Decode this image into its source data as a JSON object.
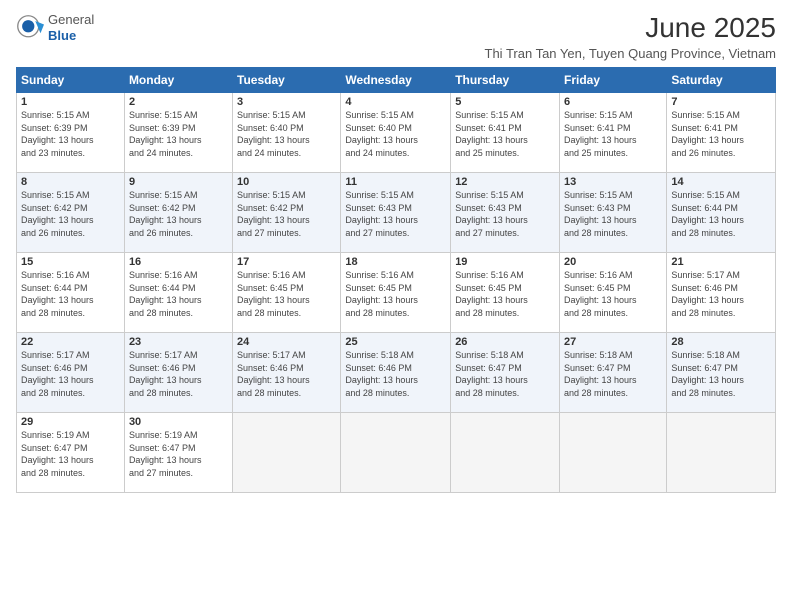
{
  "header": {
    "logo": {
      "general": "General",
      "blue": "Blue"
    },
    "title": "June 2025",
    "subtitle": "Thi Tran Tan Yen, Tuyen Quang Province, Vietnam"
  },
  "days_of_week": [
    "Sunday",
    "Monday",
    "Tuesday",
    "Wednesday",
    "Thursday",
    "Friday",
    "Saturday"
  ],
  "weeks": [
    [
      {
        "day": "1",
        "rise": "Sunrise: 5:15 AM",
        "set": "Sunset: 6:39 PM",
        "light": "Daylight: 13 hours and 23 minutes."
      },
      {
        "day": "2",
        "rise": "Sunrise: 5:15 AM",
        "set": "Sunset: 6:39 PM",
        "light": "Daylight: 13 hours and 24 minutes."
      },
      {
        "day": "3",
        "rise": "Sunrise: 5:15 AM",
        "set": "Sunset: 6:40 PM",
        "light": "Daylight: 13 hours and 24 minutes."
      },
      {
        "day": "4",
        "rise": "Sunrise: 5:15 AM",
        "set": "Sunset: 6:40 PM",
        "light": "Daylight: 13 hours and 24 minutes."
      },
      {
        "day": "5",
        "rise": "Sunrise: 5:15 AM",
        "set": "Sunset: 6:41 PM",
        "light": "Daylight: 13 hours and 25 minutes."
      },
      {
        "day": "6",
        "rise": "Sunrise: 5:15 AM",
        "set": "Sunset: 6:41 PM",
        "light": "Daylight: 13 hours and 25 minutes."
      },
      {
        "day": "7",
        "rise": "Sunrise: 5:15 AM",
        "set": "Sunset: 6:41 PM",
        "light": "Daylight: 13 hours and 26 minutes."
      }
    ],
    [
      {
        "day": "8",
        "rise": "Sunrise: 5:15 AM",
        "set": "Sunset: 6:42 PM",
        "light": "Daylight: 13 hours and 26 minutes."
      },
      {
        "day": "9",
        "rise": "Sunrise: 5:15 AM",
        "set": "Sunset: 6:42 PM",
        "light": "Daylight: 13 hours and 26 minutes."
      },
      {
        "day": "10",
        "rise": "Sunrise: 5:15 AM",
        "set": "Sunset: 6:42 PM",
        "light": "Daylight: 13 hours and 27 minutes."
      },
      {
        "day": "11",
        "rise": "Sunrise: 5:15 AM",
        "set": "Sunset: 6:43 PM",
        "light": "Daylight: 13 hours and 27 minutes."
      },
      {
        "day": "12",
        "rise": "Sunrise: 5:15 AM",
        "set": "Sunset: 6:43 PM",
        "light": "Daylight: 13 hours and 27 minutes."
      },
      {
        "day": "13",
        "rise": "Sunrise: 5:15 AM",
        "set": "Sunset: 6:43 PM",
        "light": "Daylight: 13 hours and 28 minutes."
      },
      {
        "day": "14",
        "rise": "Sunrise: 5:15 AM",
        "set": "Sunset: 6:44 PM",
        "light": "Daylight: 13 hours and 28 minutes."
      }
    ],
    [
      {
        "day": "15",
        "rise": "Sunrise: 5:16 AM",
        "set": "Sunset: 6:44 PM",
        "light": "Daylight: 13 hours and 28 minutes."
      },
      {
        "day": "16",
        "rise": "Sunrise: 5:16 AM",
        "set": "Sunset: 6:44 PM",
        "light": "Daylight: 13 hours and 28 minutes."
      },
      {
        "day": "17",
        "rise": "Sunrise: 5:16 AM",
        "set": "Sunset: 6:45 PM",
        "light": "Daylight: 13 hours and 28 minutes."
      },
      {
        "day": "18",
        "rise": "Sunrise: 5:16 AM",
        "set": "Sunset: 6:45 PM",
        "light": "Daylight: 13 hours and 28 minutes."
      },
      {
        "day": "19",
        "rise": "Sunrise: 5:16 AM",
        "set": "Sunset: 6:45 PM",
        "light": "Daylight: 13 hours and 28 minutes."
      },
      {
        "day": "20",
        "rise": "Sunrise: 5:16 AM",
        "set": "Sunset: 6:45 PM",
        "light": "Daylight: 13 hours and 28 minutes."
      },
      {
        "day": "21",
        "rise": "Sunrise: 5:17 AM",
        "set": "Sunset: 6:46 PM",
        "light": "Daylight: 13 hours and 28 minutes."
      }
    ],
    [
      {
        "day": "22",
        "rise": "Sunrise: 5:17 AM",
        "set": "Sunset: 6:46 PM",
        "light": "Daylight: 13 hours and 28 minutes."
      },
      {
        "day": "23",
        "rise": "Sunrise: 5:17 AM",
        "set": "Sunset: 6:46 PM",
        "light": "Daylight: 13 hours and 28 minutes."
      },
      {
        "day": "24",
        "rise": "Sunrise: 5:17 AM",
        "set": "Sunset: 6:46 PM",
        "light": "Daylight: 13 hours and 28 minutes."
      },
      {
        "day": "25",
        "rise": "Sunrise: 5:18 AM",
        "set": "Sunset: 6:46 PM",
        "light": "Daylight: 13 hours and 28 minutes."
      },
      {
        "day": "26",
        "rise": "Sunrise: 5:18 AM",
        "set": "Sunset: 6:47 PM",
        "light": "Daylight: 13 hours and 28 minutes."
      },
      {
        "day": "27",
        "rise": "Sunrise: 5:18 AM",
        "set": "Sunset: 6:47 PM",
        "light": "Daylight: 13 hours and 28 minutes."
      },
      {
        "day": "28",
        "rise": "Sunrise: 5:18 AM",
        "set": "Sunset: 6:47 PM",
        "light": "Daylight: 13 hours and 28 minutes."
      }
    ],
    [
      {
        "day": "29",
        "rise": "Sunrise: 5:19 AM",
        "set": "Sunset: 6:47 PM",
        "light": "Daylight: 13 hours and 28 minutes."
      },
      {
        "day": "30",
        "rise": "Sunrise: 5:19 AM",
        "set": "Sunset: 6:47 PM",
        "light": "Daylight: 13 hours and 27 minutes."
      },
      null,
      null,
      null,
      null,
      null
    ]
  ]
}
